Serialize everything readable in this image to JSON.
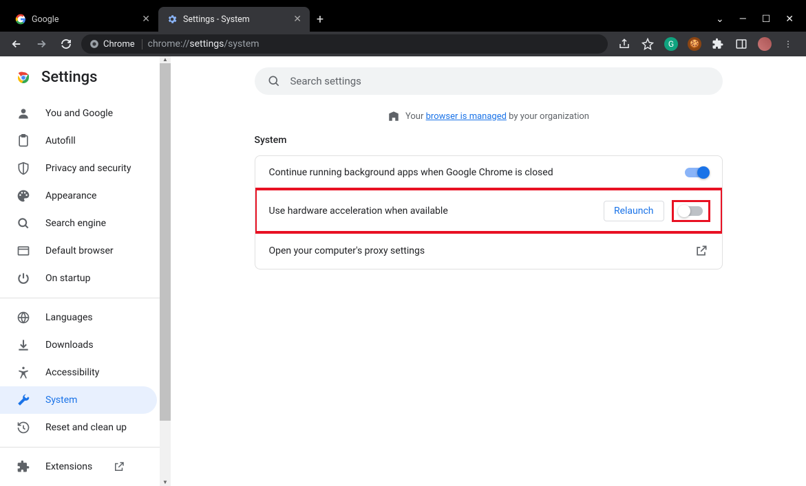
{
  "window": {
    "tabs": [
      {
        "title": "Google",
        "active": false
      },
      {
        "title": "Settings - System",
        "active": true
      }
    ]
  },
  "urlbar": {
    "badge": "Chrome",
    "url_prefix": "chrome://",
    "url_strong": "settings",
    "url_suffix": "/system"
  },
  "page": {
    "title": "Settings",
    "search_placeholder": "Search settings",
    "managed_prefix": "Your ",
    "managed_link": "browser is managed",
    "managed_suffix": " by your organization",
    "section_heading": "System"
  },
  "sidebar": {
    "groups": [
      {
        "items": [
          {
            "icon": "person",
            "label": "You and Google"
          },
          {
            "icon": "autofill",
            "label": "Autofill"
          },
          {
            "icon": "shield",
            "label": "Privacy and security"
          },
          {
            "icon": "palette",
            "label": "Appearance"
          },
          {
            "icon": "search",
            "label": "Search engine"
          },
          {
            "icon": "browser",
            "label": "Default browser"
          },
          {
            "icon": "power",
            "label": "On startup"
          }
        ]
      },
      {
        "items": [
          {
            "icon": "globe",
            "label": "Languages"
          },
          {
            "icon": "download",
            "label": "Downloads"
          },
          {
            "icon": "accessibility",
            "label": "Accessibility"
          },
          {
            "icon": "wrench",
            "label": "System",
            "active": true
          },
          {
            "icon": "restore",
            "label": "Reset and clean up"
          }
        ]
      },
      {
        "items": [
          {
            "icon": "extension",
            "label": "Extensions",
            "external": true
          }
        ]
      }
    ]
  },
  "settings": {
    "rows": [
      {
        "label": "Continue running background apps when Google Chrome is closed",
        "toggle": "on"
      },
      {
        "label": "Use hardware acceleration when available",
        "toggle": "off",
        "relaunch": "Relaunch",
        "highlighted": true
      },
      {
        "label": "Open your computer's proxy settings",
        "external": true
      }
    ]
  }
}
